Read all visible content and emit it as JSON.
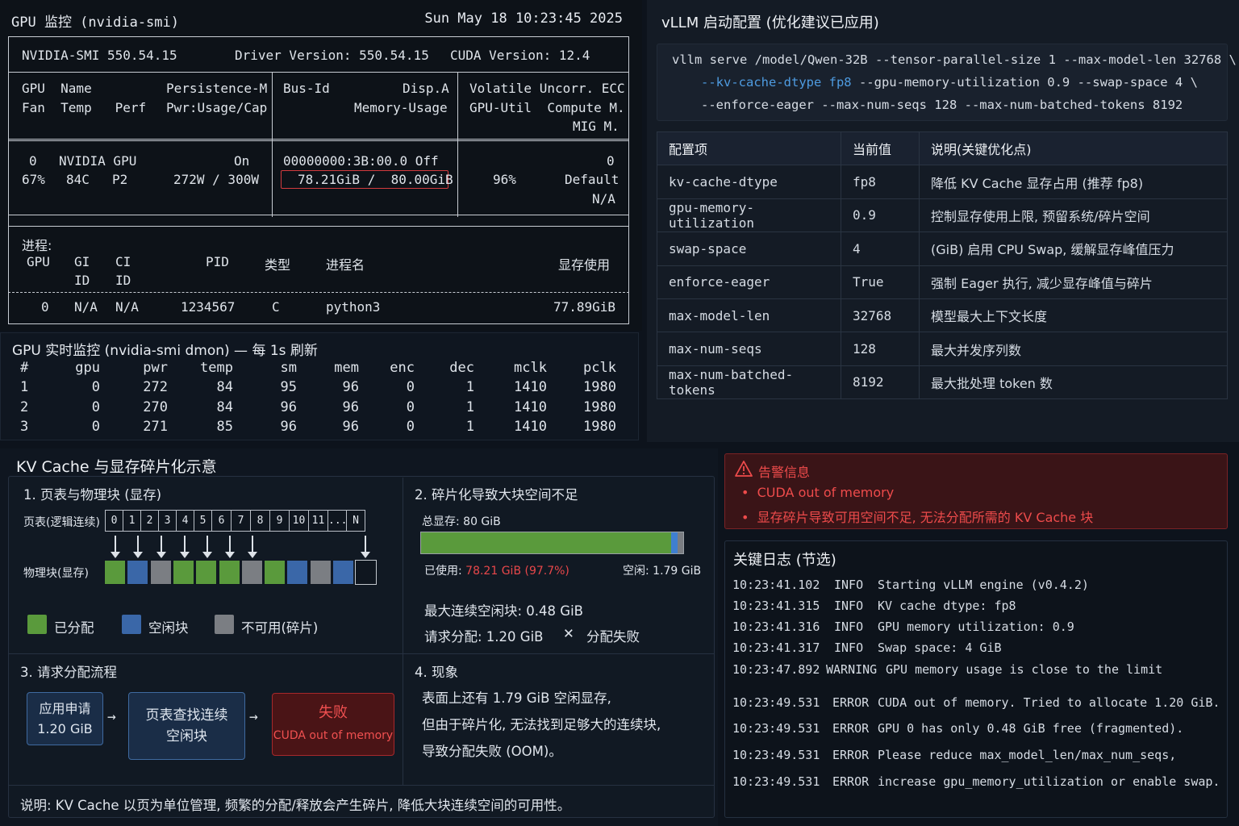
{
  "smi": {
    "title": "GPU 监控 (nvidia-smi)",
    "datetime": "Sun May 18 10:23:45 2025",
    "header_version": "NVIDIA-SMI 550.54.15",
    "driver_version": "Driver Version: 550.54.15",
    "cuda_version": "CUDA Version: 12.4",
    "col_headers": {
      "r1a": "GPU  Name",
      "r1b": "Persistence-M",
      "r1c": "Bus-Id",
      "r1d": "Disp.A",
      "r1e": "Volatile Uncorr. ECC",
      "r2a": "Fan  Temp   Perf",
      "r2b": "Pwr:Usage/Cap",
      "r2c": "Memory-Usage",
      "r2d": "GPU-Util  Compute M.",
      "r3": "MIG M."
    },
    "gpu": {
      "index": "0",
      "name": "NVIDIA GPU",
      "persistence": "On",
      "bus_id": "00000000:3B:00.0 Off",
      "ecc": "0",
      "fan": "67%",
      "temp": "84C",
      "perf": "P2",
      "power": "272W / 300W",
      "memory": "78.21GiB /  80.00GiB",
      "util": "96%",
      "compute_mode": "Default",
      "mig": "N/A"
    },
    "processes": {
      "title": "进程:",
      "headers": {
        "gpu": "GPU",
        "gi": "GI",
        "ci": "CI",
        "gi2": "ID",
        "ci2": "ID",
        "pid": "PID",
        "type": "类型",
        "name": "进程名",
        "mem": "显存使用"
      },
      "row": {
        "gpu": "0",
        "gi": "N/A",
        "ci": "N/A",
        "pid": "1234567",
        "type": "C",
        "name": "python3",
        "mem": "77.89GiB"
      }
    }
  },
  "dmon": {
    "title": "GPU 实时监控 (nvidia-smi dmon) — 每 1s 刷新",
    "headers": [
      "#",
      "gpu",
      "pwr",
      "temp",
      "sm",
      "mem",
      "enc",
      "dec",
      "mclk",
      "pclk"
    ],
    "rows": [
      [
        "1",
        "0",
        "272",
        "84",
        "95",
        "96",
        "0",
        "1",
        "1410",
        "1980"
      ],
      [
        "2",
        "0",
        "270",
        "84",
        "96",
        "96",
        "0",
        "1",
        "1410",
        "1980"
      ],
      [
        "3",
        "0",
        "271",
        "85",
        "96",
        "96",
        "0",
        "1",
        "1410",
        "1980"
      ]
    ]
  },
  "config": {
    "title": "vLLM 启动配置 (优化建议已应用)",
    "cmd_line1": "vllm serve /model/Qwen-32B --tensor-parallel-size 1 --max-model-len 32768 \\",
    "cmd_line2_hl": "--kv-cache-dtype fp8",
    "cmd_line2_rest": " --gpu-memory-utilization 0.9 --swap-space 4 \\",
    "cmd_line3": "--enforce-eager --max-num-seqs 128 --max-num-batched-tokens 8192",
    "table_headers": [
      "配置项",
      "当前值",
      "说明(关键优化点)"
    ],
    "rows": [
      {
        "key": "kv-cache-dtype",
        "value": "fp8",
        "desc": "降低 KV Cache 显存占用 (推荐 fp8)"
      },
      {
        "key": "gpu-memory-utilization",
        "value": "0.9",
        "desc": "控制显存使用上限, 预留系统/碎片空间"
      },
      {
        "key": "swap-space",
        "value": "4",
        "desc": "(GiB) 启用 CPU Swap, 缓解显存峰值压力"
      },
      {
        "key": "enforce-eager",
        "value": "True",
        "desc": "强制 Eager 执行, 减少显存峰值与碎片"
      },
      {
        "key": "max-model-len",
        "value": "32768",
        "desc": "模型最大上下文长度"
      },
      {
        "key": "max-num-seqs",
        "value": "128",
        "desc": "最大并发序列数"
      },
      {
        "key": "max-num-batched-tokens",
        "value": "8192",
        "desc": "最大批处理 token 数"
      }
    ]
  },
  "kv": {
    "title": "KV Cache 与显存碎片化示意",
    "s1_title": "1. 页表与物理块 (显存)",
    "page_table_label": "页表(逻辑连续)",
    "physical_label": "物理块(显存)",
    "page_cells": [
      "0",
      "1",
      "2",
      "3",
      "4",
      "5",
      "6",
      "7",
      "8",
      "9",
      "10",
      "11",
      "...",
      "N"
    ],
    "legend_allocated": "已分配",
    "legend_free": "空闲块",
    "legend_unusable": "不可用(碎片)",
    "s2_title": "2. 碎片化导致大块空间不足",
    "total_label": "总显存: 80 GiB",
    "used_prefix": "已使用: ",
    "used_value": "78.21 GiB (97.7%)",
    "free_label": "空闲: 1.79 GiB",
    "used_fraction": 0.955,
    "free_fraction": 0.016,
    "max_contig": "最大连续空闲块: 0.48 GiB",
    "request": "请求分配: 1.20 GiB",
    "fail_mark": "✕",
    "fail_text": "分配失败",
    "s3_title": "3. 请求分配流程",
    "flow1_line1": "应用申请",
    "flow1_line2": "1.20 GiB",
    "flow2_line1": "页表查找连续",
    "flow2_line2": "空闲块",
    "flow3_line1": "失败",
    "flow3_line2": "CUDA out of memory",
    "s4_title": "4. 现象",
    "s4_line1": "表面上还有 1.79 GiB 空闲显存,",
    "s4_line2": "但由于碎片化, 无法找到足够大的连续块,",
    "s4_line3": "导致分配失败 (OOM)。",
    "note": "说明: KV Cache 以页为单位管理, 频繁的分配/释放会产生碎片, 降低大块连续空间的可用性。"
  },
  "alert": {
    "title": "告警信息",
    "items": [
      "CUDA out of memory",
      "显存碎片导致可用空间不足, 无法分配所需的 KV Cache 块"
    ]
  },
  "log": {
    "title": "关键日志 (节选)",
    "lines": [
      {
        "time": "10:23:41.102",
        "level": "INFO",
        "msg": "Starting vLLM engine (v0.4.2)"
      },
      {
        "time": "10:23:41.315",
        "level": "INFO",
        "msg": "KV cache dtype: fp8"
      },
      {
        "time": "10:23:41.316",
        "level": "INFO",
        "msg": "GPU memory utilization: 0.9"
      },
      {
        "time": "10:23:41.317",
        "level": "INFO",
        "msg": "Swap space: 4 GiB"
      },
      {
        "time": "10:23:47.892",
        "level": "WARNING",
        "msg": "GPU memory usage is close to the limit"
      },
      {
        "time": "10:23:49.531",
        "level": "ERROR",
        "msg": "CUDA out of memory. Tried to allocate 1.20 GiB."
      },
      {
        "time": "10:23:49.531",
        "level": "ERROR",
        "msg": "GPU 0 has only 0.48 GiB free (fragmented)."
      },
      {
        "time": "10:23:49.531",
        "level": "ERROR",
        "msg": "Please reduce max_model_len/max_num_seqs,"
      },
      {
        "time": "10:23:49.531",
        "level": "ERROR",
        "msg": "increase gpu_memory_utilization or enable swap."
      }
    ]
  },
  "colors": {
    "allocated": "#5a9a3c",
    "free": "#3a67a8",
    "unusable": "#7b7e83",
    "error": "#e8474a",
    "warning": "#e8c233",
    "ok": "#5cc051"
  },
  "physical_blocks": [
    "allocated",
    "free",
    "unusable",
    "allocated",
    "allocated",
    "allocated",
    "unusable",
    "allocated",
    "free",
    "unusable",
    "free",
    "empty"
  ]
}
